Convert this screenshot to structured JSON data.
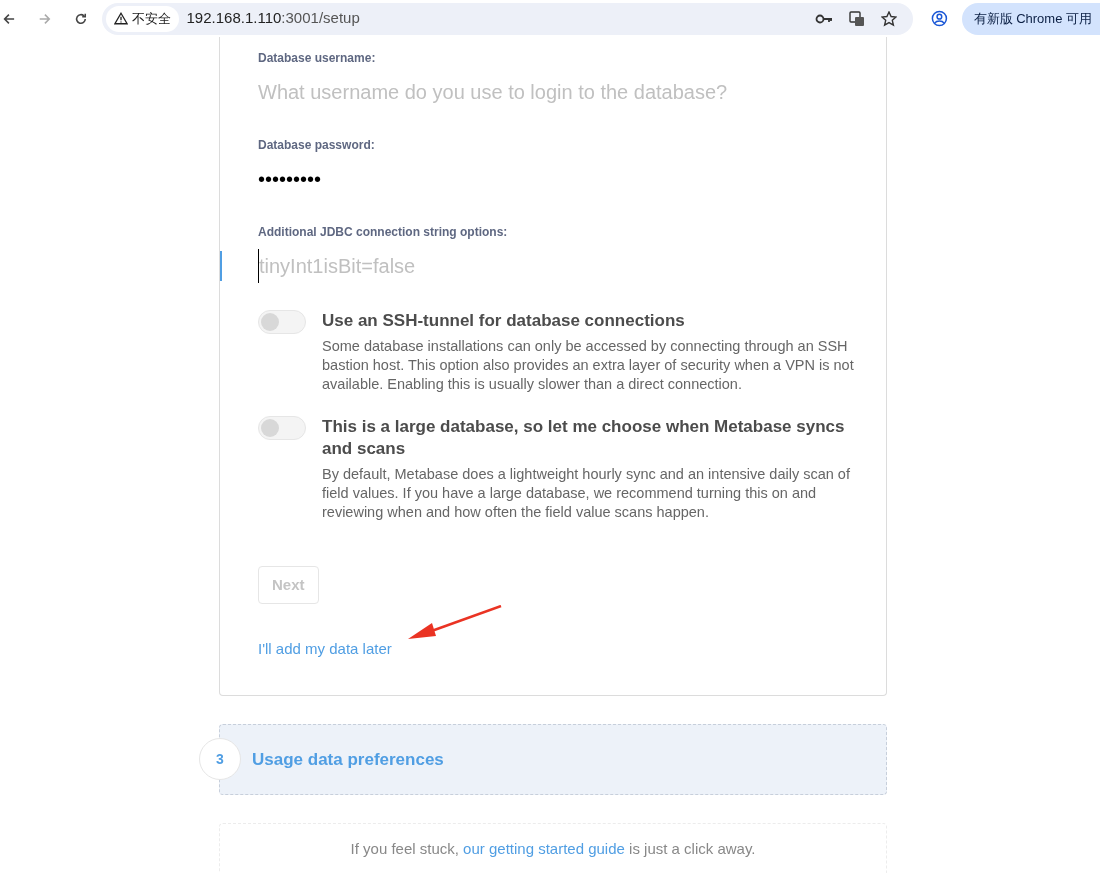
{
  "browser": {
    "security_label": "不安全",
    "url_host": "192.168.1.110",
    "url_path": ":3001/setup",
    "update_button": "有新版 Chrome 可用"
  },
  "form": {
    "fields": [
      {
        "label": "Database username:",
        "placeholder": "What username do you use to login to the database?",
        "focused": false
      },
      {
        "label": "Database password:",
        "value": "•••••••••",
        "focused": false
      },
      {
        "label": "Additional JDBC connection string options:",
        "placeholder": "tinyInt1isBit=false",
        "focused": true
      }
    ],
    "toggles": [
      {
        "title": "Use an SSH-tunnel for database connections",
        "description": "Some database installations can only be accessed by connecting through an SSH bastion host. This option also provides an extra layer of security when a VPN is not available. Enabling this is usually slower than a direct connection.",
        "on": false
      },
      {
        "title": "This is a large database, so let me choose when Metabase syncs and scans",
        "description": "By default, Metabase does a lightweight hourly sync and an intensive daily scan of field values. If you have a large database, we recommend turning this on and reviewing when and how often the field value scans happen.",
        "on": false
      }
    ],
    "next_button": {
      "label": "Next",
      "disabled": true
    },
    "skip_link": "I'll add my data later"
  },
  "next_step": {
    "number": "3",
    "title": "Usage data preferences"
  },
  "footer": {
    "before": "If you feel stuck, ",
    "link": "our getting started guide",
    "after": " is just a click away."
  }
}
